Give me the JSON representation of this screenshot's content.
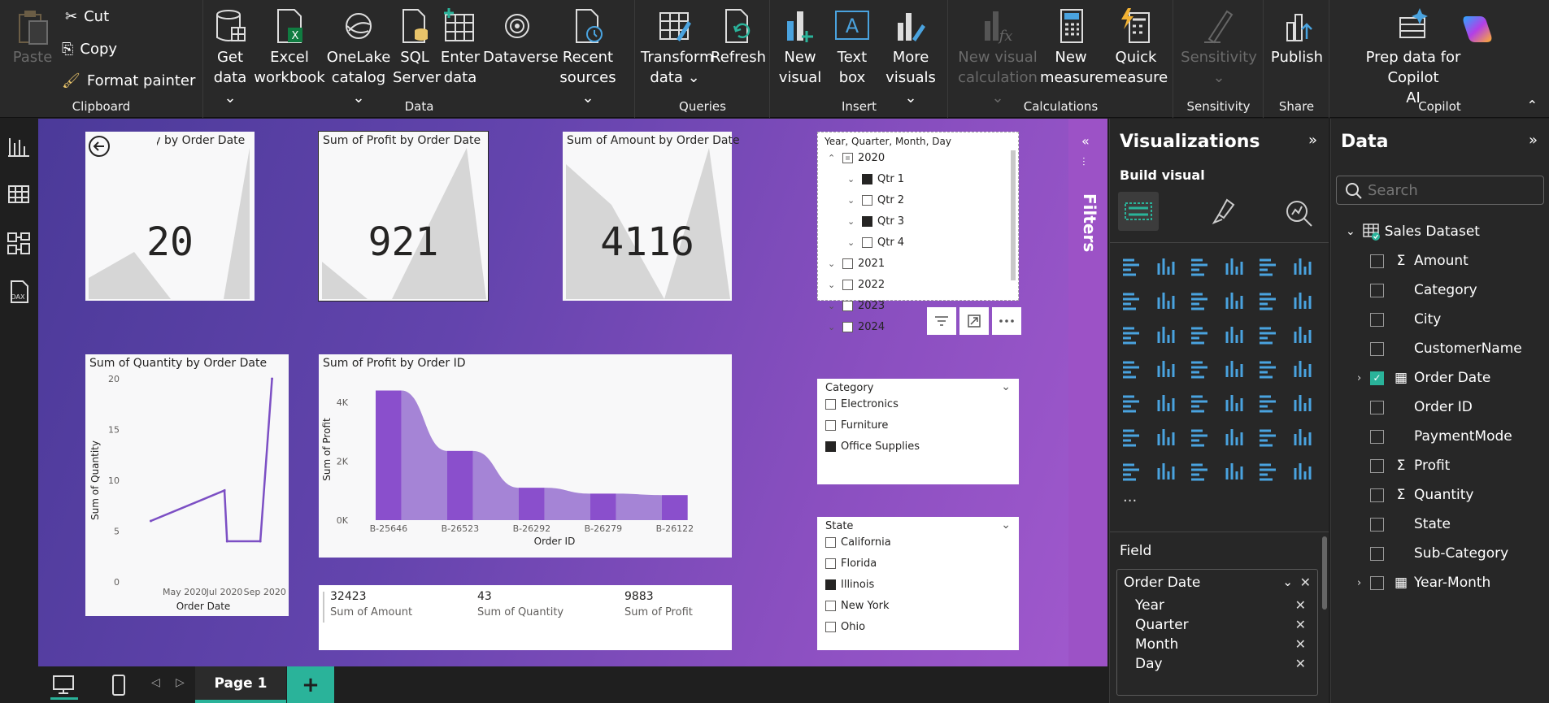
{
  "ribbon": {
    "clipboard": {
      "label": "Clipboard",
      "paste": "Paste",
      "cut": "Cut",
      "copy": "Copy",
      "format_painter": "Format painter"
    },
    "data": {
      "label": "Data",
      "get_data": [
        "Get",
        "data ⌄"
      ],
      "excel": [
        "Excel",
        "workbook"
      ],
      "onelake": [
        "OneLake",
        "catalog ⌄"
      ],
      "sql": [
        "SQL",
        "Server"
      ],
      "enter": [
        "Enter",
        "data"
      ],
      "dataverse": [
        "Dataverse"
      ],
      "recent": [
        "Recent",
        "sources ⌄"
      ]
    },
    "queries": {
      "label": "Queries",
      "transform": [
        "Transform",
        "data ⌄"
      ],
      "refresh": [
        "Refresh"
      ]
    },
    "insert": {
      "label": "Insert",
      "new_visual": [
        "New",
        "visual"
      ],
      "text_box": [
        "Text",
        "box"
      ],
      "more_visuals": [
        "More",
        "visuals ⌄"
      ]
    },
    "calculations": {
      "label": "Calculations",
      "new_visual_calc": [
        "New visual",
        "calculation ⌄"
      ],
      "new_measure": [
        "New",
        "measure"
      ],
      "quick_measure": [
        "Quick",
        "measure"
      ]
    },
    "sensitivity": {
      "label": "Sensitivity",
      "btn": [
        "Sensitivity",
        "⌄"
      ]
    },
    "share": {
      "label": "Share",
      "publish": [
        "Publish"
      ]
    },
    "copilot": {
      "label": "Copilot",
      "prep": [
        "Prep data for Copilot",
        "AI"
      ]
    }
  },
  "cards": [
    {
      "title": "Sum of Quantity by Order Date",
      "value": "20",
      "visible_title": "Quantity by Order Date"
    },
    {
      "title": "Sum of Profit by Order Date",
      "value": "921"
    },
    {
      "title": "Sum of Amount by Order Date",
      "value": "4116"
    }
  ],
  "date_slicer": {
    "header": "Year, Quarter, Month, Day",
    "items": [
      {
        "label": "2020",
        "level": 0,
        "state": "partial",
        "expanded": true
      },
      {
        "label": "Qtr 1",
        "level": 1,
        "state": "on"
      },
      {
        "label": "Qtr 2",
        "level": 1,
        "state": "off"
      },
      {
        "label": "Qtr 3",
        "level": 1,
        "state": "on"
      },
      {
        "label": "Qtr 4",
        "level": 1,
        "state": "off"
      },
      {
        "label": "2021",
        "level": 0,
        "state": "off"
      },
      {
        "label": "2022",
        "level": 0,
        "state": "off"
      },
      {
        "label": "2023",
        "level": 0,
        "state": "off"
      },
      {
        "label": "2024",
        "level": 0,
        "state": "off"
      }
    ]
  },
  "category_slicer": {
    "header": "Category",
    "items": [
      {
        "label": "Electronics",
        "on": false
      },
      {
        "label": "Furniture",
        "on": false
      },
      {
        "label": "Office Supplies",
        "on": true
      }
    ]
  },
  "state_slicer": {
    "header": "State",
    "items": [
      {
        "label": "California",
        "on": false
      },
      {
        "label": "Florida",
        "on": false
      },
      {
        "label": "Illinois",
        "on": true
      },
      {
        "label": "New York",
        "on": false
      },
      {
        "label": "Ohio",
        "on": false
      }
    ]
  },
  "multirow_card": [
    {
      "value": "32423",
      "label": "Sum of Amount"
    },
    {
      "value": "43",
      "label": "Sum of Quantity"
    },
    {
      "value": "9883",
      "label": "Sum of Profit"
    }
  ],
  "chart_data": [
    {
      "type": "line",
      "title": "Sum of Quantity by Order Date",
      "xlabel": "Order Date",
      "ylabel": "Sum of Quantity",
      "x_ticks": [
        "May 2020",
        "Jul 2020",
        "Sep 2020"
      ],
      "y_ticks": [
        0,
        5,
        10,
        15,
        20
      ],
      "ylim": [
        0,
        20
      ],
      "x": [
        "2020-03-10",
        "2020-07-01",
        "2020-07-05",
        "2020-08-25",
        "2020-09-12"
      ],
      "y": [
        6,
        9,
        4,
        4,
        20
      ],
      "color": "#7c4fc4"
    },
    {
      "type": "bar",
      "title": "Sum of Profit by Order ID",
      "xlabel": "Order ID",
      "ylabel": "Sum of Profit",
      "categories": [
        "B-25646",
        "B-26523",
        "B-26292",
        "B-26279",
        "B-26122"
      ],
      "values": [
        4400,
        2350,
        1100,
        900,
        850
      ],
      "y_ticks": [
        "0K",
        "2K",
        "4K"
      ],
      "ylim": [
        0,
        4800
      ],
      "color": "#8a4fcc",
      "ribbon_color": "#a584d6"
    }
  ],
  "filters_label": "Filters",
  "visualizations": {
    "title": "Visualizations",
    "build": "Build visual",
    "field_label": "Field",
    "field_well": "Order Date",
    "field_items": [
      "Year",
      "Quarter",
      "Month",
      "Day"
    ]
  },
  "data_pane": {
    "title": "Data",
    "search_placeholder": "Search",
    "dataset": "Sales Dataset",
    "fields": [
      {
        "label": "Amount",
        "sigma": true,
        "checked": false
      },
      {
        "label": "Category",
        "sigma": false,
        "checked": false
      },
      {
        "label": "City",
        "sigma": false,
        "checked": false
      },
      {
        "label": "CustomerName",
        "sigma": false,
        "checked": false
      },
      {
        "label": "Order Date",
        "sigma": false,
        "checked": true,
        "expandable": true,
        "calendar": true
      },
      {
        "label": "Order ID",
        "sigma": false,
        "checked": false
      },
      {
        "label": "PaymentMode",
        "sigma": false,
        "checked": false
      },
      {
        "label": "Profit",
        "sigma": true,
        "checked": false
      },
      {
        "label": "Quantity",
        "sigma": true,
        "checked": false
      },
      {
        "label": "State",
        "sigma": false,
        "checked": false
      },
      {
        "label": "Sub-Category",
        "sigma": false,
        "checked": false
      },
      {
        "label": "Year-Month",
        "sigma": false,
        "checked": false,
        "expandable": true,
        "calendar": true
      }
    ]
  },
  "page_tab": "Page 1",
  "colors": {
    "accent": "#2ab39a",
    "purple": "#8a4fcc",
    "ribbon_bg": "#292929"
  }
}
